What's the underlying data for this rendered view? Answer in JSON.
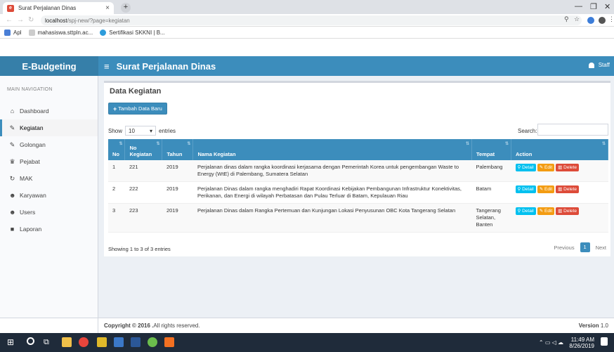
{
  "browser": {
    "tab_title": "Surat Perjalanan Dinas",
    "tab_close": "×",
    "new_tab": "+",
    "url_host": "localhost",
    "url_path": "/spj-new/?page=kegiatan",
    "bookmarks": [
      "Apl",
      "mahasiswa.sttpln.ac...",
      "Sertifikasi SKKNI | B..."
    ]
  },
  "app": {
    "logo": "E-Budgeting",
    "page_title": "Surat Perjalanan Dinas",
    "user": "Staff",
    "accent": "#3c8dbc"
  },
  "sidebar": {
    "header": "MAIN NAVIGATION",
    "items": [
      {
        "label": "Dashboard",
        "icon": "home-icon"
      },
      {
        "label": "Kegiatan",
        "icon": "edit-icon",
        "active": true
      },
      {
        "label": "Golongan",
        "icon": "edit-icon"
      },
      {
        "label": "Pejabat",
        "icon": "trophy-icon"
      },
      {
        "label": "MAK",
        "icon": "refresh-icon"
      },
      {
        "label": "Karyawan",
        "icon": "users-icon"
      },
      {
        "label": "Users",
        "icon": "users-icon"
      },
      {
        "label": "Laporan",
        "icon": "folder-icon"
      }
    ]
  },
  "content": {
    "box_title": "Data Kegiatan",
    "add_button": "Tambah Data Baru",
    "show_label": "Show",
    "show_value": "10",
    "entries_label": "entries",
    "search_label": "Search:",
    "search_value": "",
    "columns": [
      "No",
      "No Kegiatan",
      "Tahun",
      "Nama Kegiatan",
      "Tempat",
      "Action"
    ],
    "rows": [
      {
        "no": "1",
        "no_kegiatan": "221",
        "tahun": "2019",
        "nama": "Perjalanan dinas dalam rangka koordinasi kerjasama dengan Pemerintah Korea untuk pengembangan Waste to Energy (WtE) di Palembang, Sumatera Selatan",
        "tempat": "Palembang"
      },
      {
        "no": "2",
        "no_kegiatan": "222",
        "tahun": "2019",
        "nama": "Perjalanan Dinas dalam rangka menghadiri Rapat Koordinasi Kebijakan Pembangunan Infrastruktur Konektivitas, Perikanan, dan Energi di wilayah Perbatasan dan Pulau Terluar di Batam, Kepulauan Riau",
        "tempat": "Batam"
      },
      {
        "no": "3",
        "no_kegiatan": "223",
        "tahun": "2019",
        "nama": "Perjalanan Dinas dalam Rangka Pertemuan dan Kunjungan Lokasi Penyusunan OBC Kota Tangerang Selatan",
        "tempat": "Tangerang Selatan, Banten"
      }
    ],
    "actions": {
      "detail": "Detail",
      "edit": "Edit",
      "delete": "Delete"
    },
    "info": "Showing 1 to 3 of 3 entries",
    "pager": {
      "previous": "Previous",
      "page": "1",
      "next": "Next"
    }
  },
  "footer": {
    "copyright_bold": "Copyright © 2016 .",
    "copyright_rest": " All rights reserved.",
    "version_bold": "Version",
    "version": "1.0"
  },
  "taskbar": {
    "time": "11:49 AM",
    "date": "8/26/2019"
  }
}
